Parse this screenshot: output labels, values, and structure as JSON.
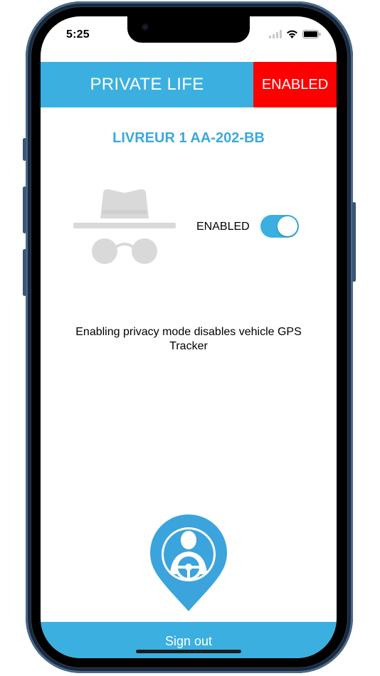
{
  "status_bar": {
    "time": "5:25",
    "icons": [
      "cellular-signal-icon",
      "wifi-icon",
      "battery-icon"
    ]
  },
  "header": {
    "title": "PRIVATE LIFE",
    "status_badge": "ENABLED",
    "background_color": "#3bb0e0",
    "badge_color": "#ff0000"
  },
  "vehicle": {
    "title": "LIVREUR 1 AA-202-BB",
    "color": "#3ba9db"
  },
  "privacy_mode": {
    "icon": "incognito-icon",
    "toggle_label": "ENABLED",
    "enabled": true,
    "description": "Enabling privacy mode disables vehicle GPS Tracker"
  },
  "logo": {
    "icon": "driver-location-pin-icon"
  },
  "footer": {
    "sign_out_label": "Sign out"
  }
}
